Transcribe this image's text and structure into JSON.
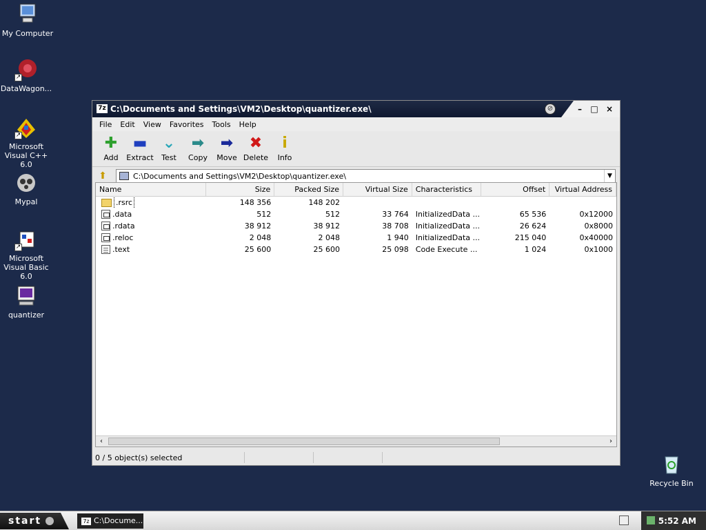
{
  "desktop": {
    "icons": [
      {
        "label": "My Computer"
      },
      {
        "label": "DataWagon..."
      },
      {
        "label": "Microsoft Visual C++ 6.0"
      },
      {
        "label": "Mypal"
      },
      {
        "label": "Microsoft Visual Basic 6.0"
      },
      {
        "label": "quantizer"
      },
      {
        "label": "Recycle Bin"
      }
    ]
  },
  "window": {
    "app_icon": "7z",
    "title": "C:\\Documents and Settings\\VM2\\Desktop\\quantizer.exe\\",
    "menu": [
      "File",
      "Edit",
      "View",
      "Favorites",
      "Tools",
      "Help"
    ],
    "toolbar": [
      {
        "label": "Add",
        "icon": "plus-icon",
        "color": "#2ea02e"
      },
      {
        "label": "Extract",
        "icon": "minus-icon",
        "color": "#1f3fbf"
      },
      {
        "label": "Test",
        "icon": "check-icon",
        "color": "#2aa7b8"
      },
      {
        "label": "Copy",
        "icon": "arrow-right-icon",
        "color": "#2a8a8a"
      },
      {
        "label": "Move",
        "icon": "arrow-right-icon",
        "color": "#1a2a9a"
      },
      {
        "label": "Delete",
        "icon": "x-icon",
        "color": "#d01818"
      },
      {
        "label": "Info",
        "icon": "info-icon",
        "color": "#c8a800"
      }
    ],
    "address": "C:\\Documents and Settings\\VM2\\Desktop\\quantizer.exe\\",
    "columns": [
      "Name",
      "Size",
      "Packed Size",
      "Virtual Size",
      "Characteristics",
      "Offset",
      "Virtual Address"
    ],
    "rows": [
      {
        "name": ".rsrc",
        "size": "148 356",
        "packed": "148 202",
        "vsize": "",
        "chars": "",
        "offset": "",
        "vaddr": ""
      },
      {
        "name": ".data",
        "size": "512",
        "packed": "512",
        "vsize": "33 764",
        "chars": "InitializedData ...",
        "offset": "65 536",
        "vaddr": "0x12000"
      },
      {
        "name": ".rdata",
        "size": "38 912",
        "packed": "38 912",
        "vsize": "38 708",
        "chars": "InitializedData ...",
        "offset": "26 624",
        "vaddr": "0x8000"
      },
      {
        "name": ".reloc",
        "size": "2 048",
        "packed": "2 048",
        "vsize": "1 940",
        "chars": "InitializedData ...",
        "offset": "215 040",
        "vaddr": "0x40000"
      },
      {
        "name": ".text",
        "size": "25 600",
        "packed": "25 600",
        "vsize": "25 098",
        "chars": "Code Execute ...",
        "offset": "1 024",
        "vaddr": "0x1000"
      }
    ],
    "status": "0 / 5 object(s) selected"
  },
  "taskbar": {
    "start_label": "start",
    "task_label": "C:\\Docume...",
    "clock": "5:52 AM"
  }
}
